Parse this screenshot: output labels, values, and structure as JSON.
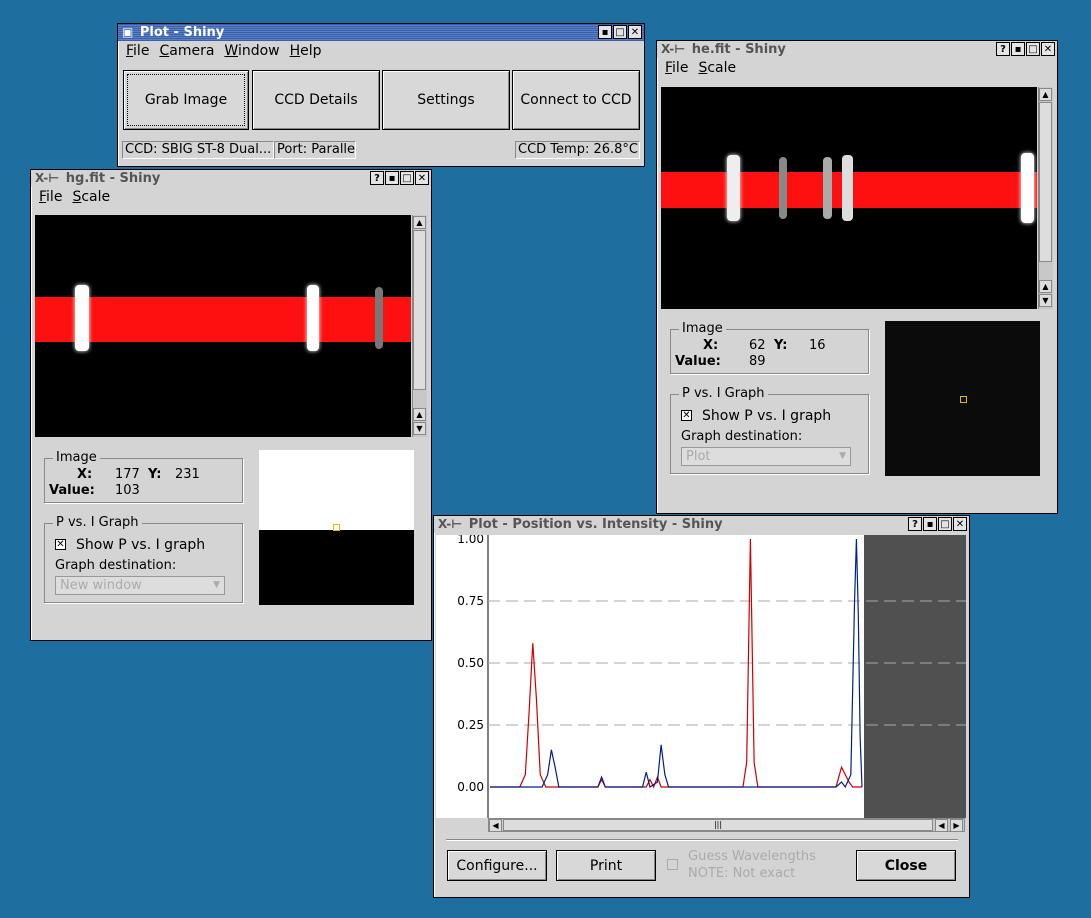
{
  "colors": {
    "desktop": "#1e6f9f",
    "red_series": "#d00000",
    "blue_series": "#00208a",
    "band": "#ff1010"
  },
  "plot_main": {
    "title": "Plot - Shiny",
    "menu": [
      "File",
      "Camera",
      "Window",
      "Help"
    ],
    "buttons": [
      "Grab Image",
      "CCD Details",
      "Settings",
      "Connect to CCD"
    ],
    "status_ccd": "CCD: SBIG ST-8 Dual...",
    "status_port": "Port: Parallel",
    "status_temp": "CCD Temp: 26.8°C"
  },
  "hg": {
    "title": "hg.fit - Shiny",
    "menu": [
      "File",
      "Scale"
    ],
    "image_group": "Image",
    "x_label": "X:",
    "x_value": "177",
    "y_label": "Y:",
    "y_value": "231",
    "value_label": "Value:",
    "value": "103",
    "pvi_group": "P vs. I Graph",
    "show_pvi": "Show P vs. I graph",
    "graph_dest_label": "Graph destination:",
    "graph_dest_value": "New window"
  },
  "he": {
    "title": "he.fit - Shiny",
    "menu": [
      "File",
      "Scale"
    ],
    "image_group": "Image",
    "x_label": "X:",
    "x_value": "62",
    "y_label": "Y:",
    "y_value": "16",
    "value_label": "Value:",
    "value": "89",
    "pvi_group": "P vs. I Graph",
    "show_pvi": "Show P vs. I graph",
    "graph_dest_label": "Graph destination:",
    "graph_dest_value": "Plot"
  },
  "pvi": {
    "title": "Plot - Position vs. Intensity - Shiny",
    "configure": "Configure...",
    "print": "Print",
    "guess": "Guess Wavelengths",
    "note": "NOTE: Not exact",
    "close": "Close"
  },
  "chart_data": {
    "type": "line",
    "title": "",
    "xlabel": "",
    "ylabel": "",
    "ylim": [
      0,
      1.0
    ],
    "yticks": [
      "1.00",
      "0.75",
      "0.50",
      "0.25",
      "0.00"
    ],
    "grid": true,
    "series": [
      {
        "color": "#d00000",
        "points": [
          [
            0,
            0.0
          ],
          [
            0.08,
            0.0
          ],
          [
            0.095,
            0.05
          ],
          [
            0.105,
            0.3
          ],
          [
            0.115,
            0.58
          ],
          [
            0.125,
            0.35
          ],
          [
            0.135,
            0.05
          ],
          [
            0.15,
            0.0
          ],
          [
            0.29,
            0.0
          ],
          [
            0.3,
            0.03
          ],
          [
            0.31,
            0.0
          ],
          [
            0.42,
            0.0
          ],
          [
            0.43,
            0.03
          ],
          [
            0.44,
            0.0
          ],
          [
            0.45,
            0.04
          ],
          [
            0.46,
            0.0
          ],
          [
            0.68,
            0.0
          ],
          [
            0.69,
            0.1
          ],
          [
            0.7,
            1.0
          ],
          [
            0.71,
            0.1
          ],
          [
            0.72,
            0.0
          ],
          [
            0.93,
            0.0
          ],
          [
            0.945,
            0.08
          ],
          [
            0.955,
            0.05
          ],
          [
            0.965,
            0.02
          ],
          [
            0.975,
            0.0
          ],
          [
            1.0,
            0.0
          ]
        ]
      },
      {
        "color": "#00208a",
        "points": [
          [
            0,
            0.0
          ],
          [
            0.14,
            0.0
          ],
          [
            0.155,
            0.05
          ],
          [
            0.165,
            0.15
          ],
          [
            0.175,
            0.08
          ],
          [
            0.185,
            0.0
          ],
          [
            0.29,
            0.0
          ],
          [
            0.3,
            0.04
          ],
          [
            0.31,
            0.0
          ],
          [
            0.41,
            0.0
          ],
          [
            0.42,
            0.06
          ],
          [
            0.43,
            0.0
          ],
          [
            0.45,
            0.02
          ],
          [
            0.46,
            0.17
          ],
          [
            0.47,
            0.05
          ],
          [
            0.48,
            0.0
          ],
          [
            0.93,
            0.0
          ],
          [
            0.945,
            0.02
          ],
          [
            0.955,
            0.0
          ],
          [
            0.97,
            0.05
          ],
          [
            0.98,
            0.75
          ],
          [
            0.985,
            1.0
          ],
          [
            0.99,
            0.7
          ],
          [
            0.995,
            0.2
          ],
          [
            1.0,
            0.0
          ]
        ]
      }
    ]
  }
}
